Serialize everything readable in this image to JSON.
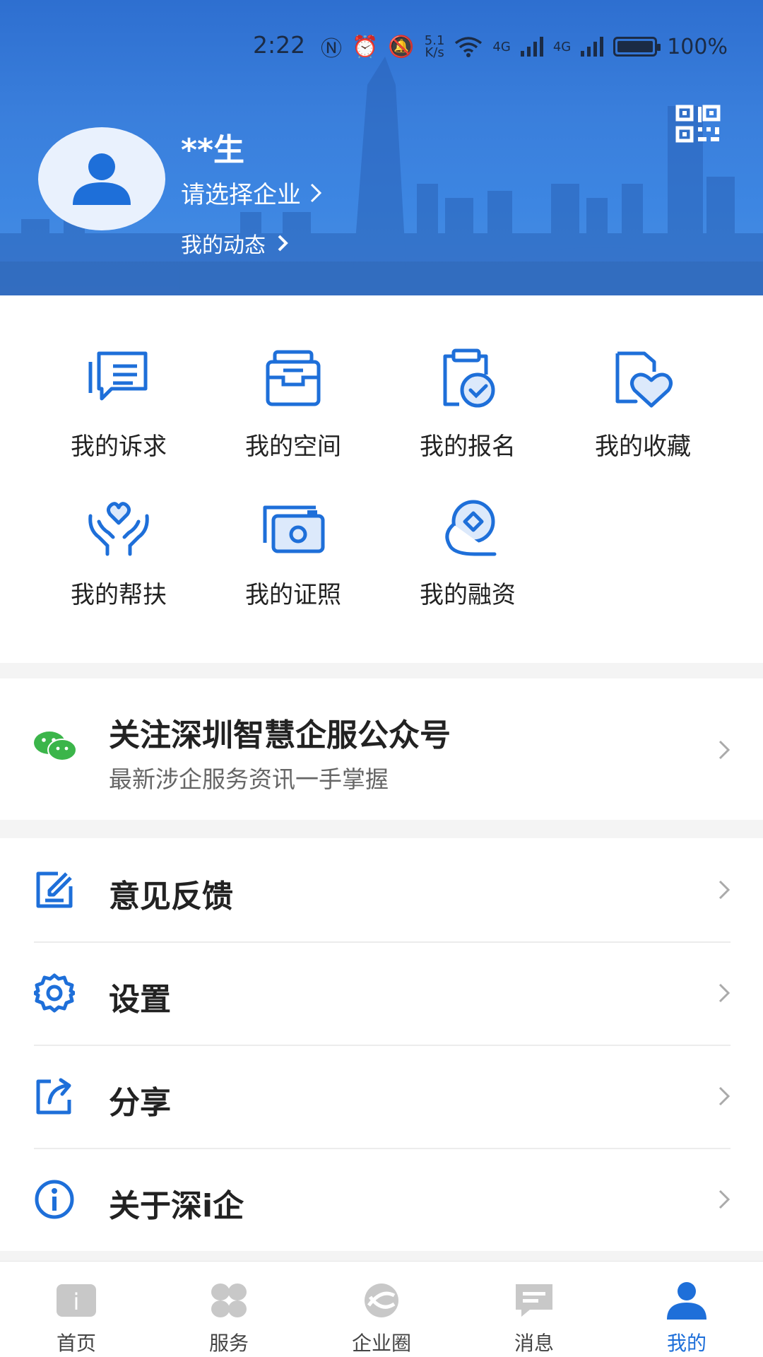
{
  "status_bar": {
    "time": "2:22",
    "net_speed_top": "5.1",
    "net_speed_bottom": "K/s",
    "signal_1": "4G",
    "signal_2": "4G",
    "battery": "100%"
  },
  "profile": {
    "name": "**生",
    "company_prompt": "请选择企业",
    "activity_label": "我的动态",
    "qr_icon": "qr-code-icon",
    "avatar_icon": "user-avatar-icon"
  },
  "grid": [
    {
      "label": "我的诉求",
      "icon": "message-icon"
    },
    {
      "label": "我的空间",
      "icon": "inbox-icon"
    },
    {
      "label": "我的报名",
      "icon": "clipboard-check-icon"
    },
    {
      "label": "我的收藏",
      "icon": "heart-folder-icon"
    },
    {
      "label": "我的帮扶",
      "icon": "hands-heart-icon"
    },
    {
      "label": "我的证照",
      "icon": "camera-card-icon"
    },
    {
      "label": "我的融资",
      "icon": "money-hand-icon"
    }
  ],
  "wechat": {
    "title": "关注深圳智慧企服公众号",
    "subtitle": "最新涉企服务资讯一手掌握",
    "icon": "wechat-icon"
  },
  "menu": [
    {
      "label": "意见反馈",
      "icon": "edit-icon"
    },
    {
      "label": "设置",
      "icon": "gear-icon"
    },
    {
      "label": "分享",
      "icon": "share-icon"
    },
    {
      "label": "关于深i企",
      "icon": "info-icon"
    }
  ],
  "tabs": [
    {
      "label": "首页",
      "icon": "home-icon",
      "active": false
    },
    {
      "label": "服务",
      "icon": "services-icon",
      "active": false
    },
    {
      "label": "企业圈",
      "icon": "circle-icon",
      "active": false
    },
    {
      "label": "消息",
      "icon": "message-icon",
      "active": false
    },
    {
      "label": "我的",
      "icon": "profile-icon",
      "active": true
    }
  ],
  "colors": {
    "accent": "#1e6fd9",
    "header_bg": "#3a7fdc",
    "wechat_green": "#3bb54a",
    "inactive_icon": "#c8c8c8"
  }
}
